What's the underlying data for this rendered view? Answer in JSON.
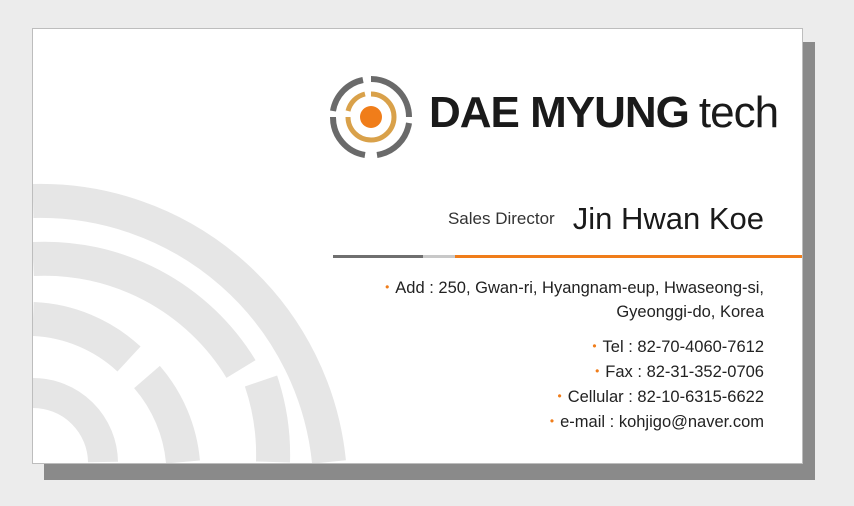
{
  "brand": {
    "name_bold": "DAE MYUNG",
    "name_light": "tech"
  },
  "person": {
    "title": "Sales Director",
    "name": "Jin Hwan Koe"
  },
  "address": {
    "label": "Add",
    "line1": "250, Gwan-ri, Hyangnam-eup, Hwaseong-si,",
    "line2": "Gyeonggi-do, Korea"
  },
  "contacts": [
    {
      "label": "Tel",
      "value": "82-70-4060-7612"
    },
    {
      "label": "Fax",
      "value": "82-31-352-0706"
    },
    {
      "label": "Cellular",
      "value": "82-10-6315-6622"
    },
    {
      "label": "e-mail",
      "value": "kohjigo@naver.com"
    }
  ],
  "colors": {
    "accent": "#f07d1a",
    "emblem_gold": "#d9a14a",
    "text": "#1a1a1a",
    "watermark": "#e6e6e6"
  }
}
